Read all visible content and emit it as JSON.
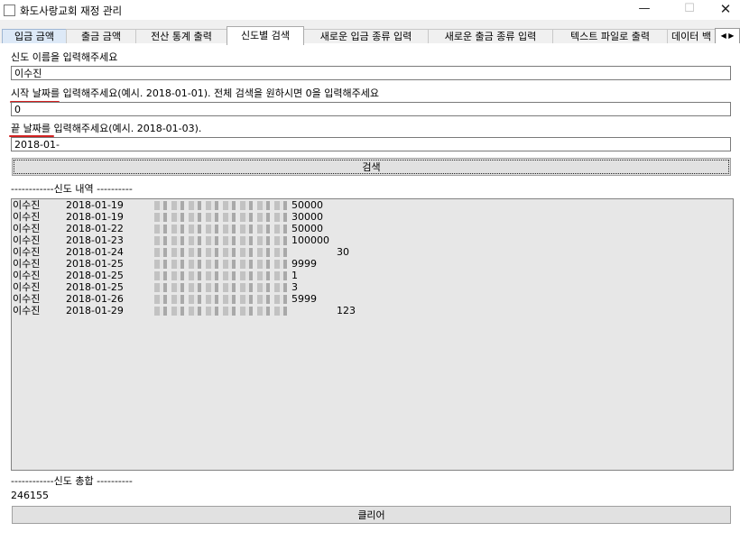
{
  "window": {
    "title": "화도사랑교회 재정 관리",
    "min": "—",
    "max": "☐",
    "close": "✕"
  },
  "tabs": [
    "입금 금액",
    "출금 금액",
    "전산 통계 출력",
    "신도별 검색",
    "새로운 입금 종류 입력",
    "새로운 출금 종류 입력",
    "텍스트 파일로 출력",
    "데이터 백"
  ],
  "tab_arrows": "◀ ▶",
  "form": {
    "name_label": "신도 이름을 입력해주세요",
    "name_value": "이수진",
    "start_label": "시작 날짜를 입력해주세요(예시. 2018-01-01). 전체 검색을 원하시면 0을 입력해주세요",
    "start_value": "0",
    "end_label": "끝 날짜를 입력해주세요(예시. 2018-01-03).",
    "end_value": "2018-01-",
    "search_button": "검색"
  },
  "history": {
    "header": "------------신도 내역 ----------",
    "rows": [
      {
        "name": "이수진",
        "date": "2018-01-19",
        "amount": "50000",
        "extra": ""
      },
      {
        "name": "이수진",
        "date": "2018-01-19",
        "amount": "30000",
        "extra": ""
      },
      {
        "name": "이수진",
        "date": "2018-01-22",
        "amount": "50000",
        "extra": ""
      },
      {
        "name": "이수진",
        "date": "2018-01-23",
        "amount": "100000",
        "extra": ""
      },
      {
        "name": "이수진",
        "date": "2018-01-24",
        "amount": "",
        "extra": "30"
      },
      {
        "name": "이수진",
        "date": "2018-01-25",
        "amount": "9999",
        "extra": ""
      },
      {
        "name": "이수진",
        "date": "2018-01-25",
        "amount": "1",
        "extra": ""
      },
      {
        "name": "이수진",
        "date": "2018-01-25",
        "amount": "3",
        "extra": ""
      },
      {
        "name": "이수진",
        "date": "2018-01-26",
        "amount": "5999",
        "extra": ""
      },
      {
        "name": "이수진",
        "date": "2018-01-29",
        "amount": "",
        "extra": "123"
      }
    ]
  },
  "total": {
    "header": "------------신도 총합 ----------",
    "value": "246155"
  },
  "clear_button": "클리어",
  "colors": {
    "annotation_underline": "#d12020",
    "list_bg": "#e7e7e7"
  }
}
